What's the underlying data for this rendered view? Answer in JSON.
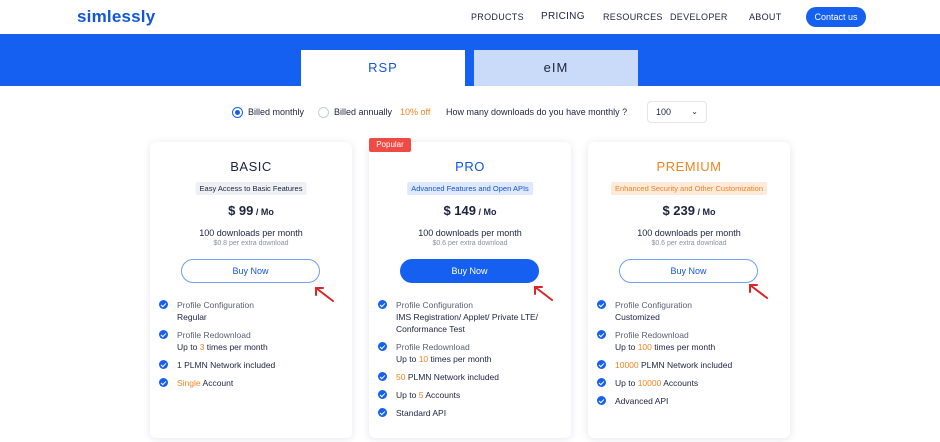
{
  "nav": {
    "logo": "simlessly",
    "links": [
      "PRODUCTS",
      "PRICING",
      "RESOURCES",
      "DEVELOPER",
      "ABOUT"
    ],
    "contact": "Contact us"
  },
  "tabs": {
    "rsp": "RSP",
    "eim": "eIM"
  },
  "billing": {
    "monthly": "Billed monthly",
    "annually": "Billed annually",
    "discount": "10% off",
    "question": "How many downloads do you have monthly ?",
    "selected": "100"
  },
  "popular_badge": "Popular",
  "plans": [
    {
      "name": "BASIC",
      "subtitle": "Easy Access to Basic Features",
      "price": "$ 99",
      "per": " / Mo",
      "downloads": "100 downloads per month",
      "extra": "$0.8 per extra download",
      "buy": "Buy Now",
      "features": {
        "f1_label": "Profile Configuration",
        "f1_value": "Regular",
        "f2_label": "Profile Redownload",
        "f2_pre": "Up to ",
        "f2_hl": "3",
        "f2_post": " times per month",
        "f3_hl": "1",
        "f3_post": " PLMN Network included",
        "f4_hl": "Single",
        "f4_post": " Account"
      }
    },
    {
      "name": "PRO",
      "subtitle": "Advanced Features and Open APIs",
      "price": "$ 149",
      "per": " / Mo",
      "downloads": "100 downloads per month",
      "extra": "$0.6 per extra download",
      "buy": "Buy Now",
      "features": {
        "f1_label": "Profile Configuration",
        "f1_value": "IMS Registration/ Applet/ Private LTE/ Conformance Test",
        "f2_label": "Profile Redownload",
        "f2_pre": "Up to ",
        "f2_hl": "10",
        "f2_post": " times per month",
        "f3_hl": "50",
        "f3_post": " PLMN Network included",
        "f4_pre": "Up to ",
        "f4_hl": "5",
        "f4_post": " Accounts",
        "f5": "Standard API"
      }
    },
    {
      "name": "PREMIUM",
      "subtitle": "Enhanced Security and Other Customization",
      "price": "$ 239",
      "per": " / Mo",
      "downloads": "100 downloads per month",
      "extra": "$0.6 per extra download",
      "buy": "Buy Now",
      "features": {
        "f1_label": "Profile Configuration",
        "f1_value": "Customized",
        "f2_label": "Profile Redownload",
        "f2_pre": "Up to ",
        "f2_hl": "100",
        "f2_post": " times per month",
        "f3_hl": "10000",
        "f3_post": " PLMN Network included",
        "f4_pre": "Up to ",
        "f4_hl": "10000",
        "f4_post": " Accounts",
        "f5": "Advanced API"
      }
    }
  ],
  "colors": {
    "brand": "#1560f0",
    "accent": "#f2831f",
    "badge": "#ef4a43",
    "annotation_arrow": "#d8262a"
  },
  "icons": {
    "check": "check-circle-icon",
    "chevron": "chevron-down-icon",
    "arrow": "red-annotation-arrow-icon"
  }
}
